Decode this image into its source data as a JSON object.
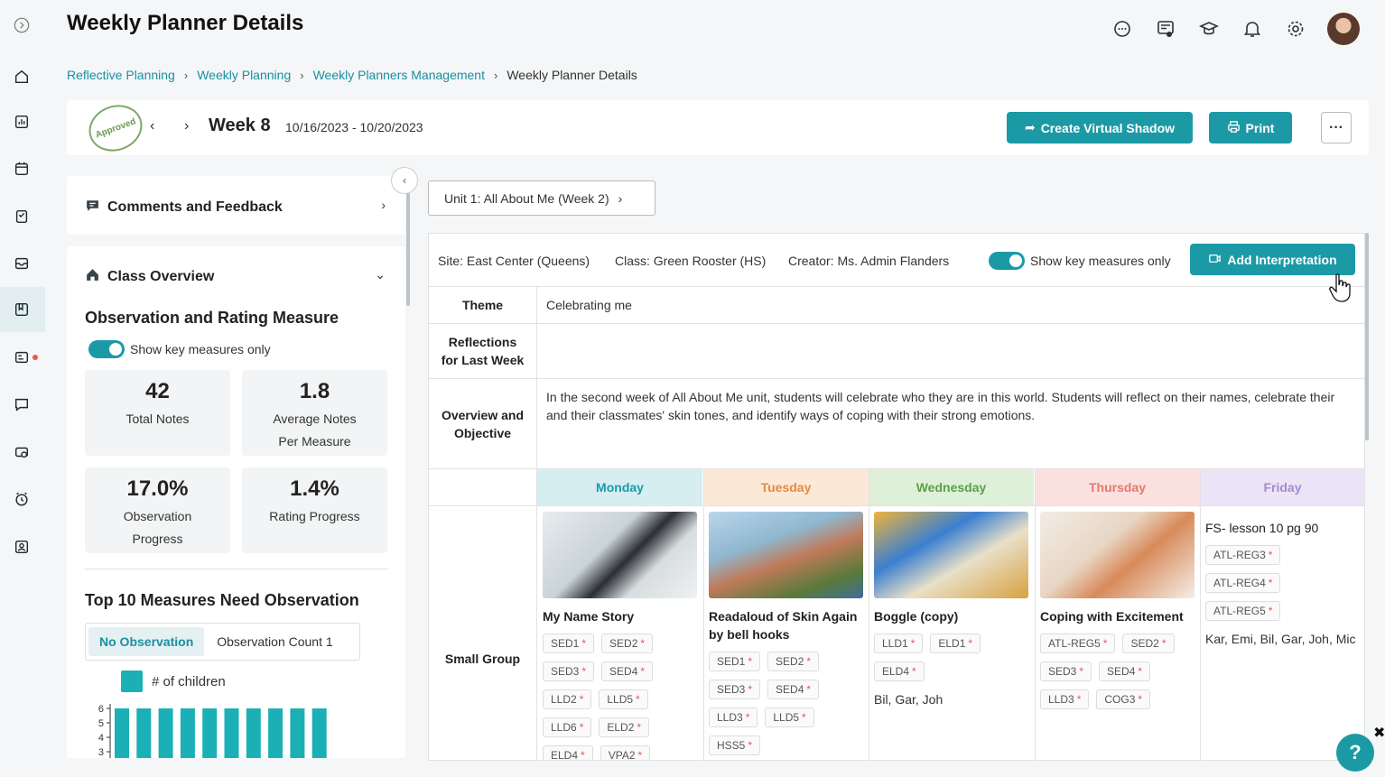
{
  "header": {
    "title": "Weekly Planner Details",
    "icons": [
      "chat-icon",
      "feedback-icon",
      "graduation-cap-icon",
      "bell-icon",
      "gear-icon",
      "avatar"
    ]
  },
  "sidebar": {
    "items": [
      "expand-icon",
      "home-icon",
      "chart-icon",
      "calendar-icon",
      "clipboard-icon",
      "inbox-icon",
      "planner-icon",
      "report-icon",
      "message-icon",
      "media-icon",
      "clock-icon",
      "profile-icon"
    ]
  },
  "breadcrumb": {
    "items": [
      "Reflective Planning",
      "Weekly Planning",
      "Weekly Planners Management"
    ],
    "current": "Weekly Planner Details"
  },
  "week": {
    "stamp": "Approved",
    "label": "Week 8",
    "dates": "10/16/2023 - 10/20/2023",
    "create_label": "Create Virtual Shadow",
    "print_label": "Print",
    "more_label": "···"
  },
  "left_panel": {
    "comments_title": "Comments and Feedback",
    "class_title": "Class Overview",
    "measure_title": "Observation and Rating Measure",
    "toggle_label": "Show key measures only",
    "stats": [
      {
        "value": "42",
        "label1": "Total Notes",
        "label2": ""
      },
      {
        "value": "1.8",
        "label1": "Average Notes",
        "label2": "Per Measure"
      },
      {
        "value": "17.0%",
        "label1": "Observation",
        "label2": "Progress"
      },
      {
        "value": "1.4%",
        "label1": "Rating Progress",
        "label2": ""
      }
    ],
    "top10_title": "Top 10 Measures Need Observation",
    "tab_active": "No Observation",
    "tab_inactive": "Observation Count 1",
    "legend": "# of children",
    "y_ticks": [
      "6",
      "5",
      "4",
      "3"
    ]
  },
  "chart_data": {
    "type": "bar",
    "categories": [
      "",
      "",
      "",
      "",
      "",
      "",
      "",
      "",
      "",
      ""
    ],
    "values": [
      6,
      6,
      6,
      6,
      6,
      6,
      6,
      6,
      6,
      6
    ],
    "ylim": [
      3,
      6
    ],
    "series_name": "# of children",
    "color": "#1bb0b5"
  },
  "unit": {
    "label": "Unit 1: All About Me (Week 2)"
  },
  "details": {
    "site": "Site: East Center (Queens)",
    "class": "Class: Green Rooster (HS)",
    "creator": "Creator: Ms. Admin Flanders",
    "toggle_label": "Show key measures only",
    "add_label": "Add Interpretation",
    "theme_head": "Theme",
    "theme": "Celebrating me",
    "reflections_head1": "Reflections",
    "reflections_head2": "for Last Week",
    "overview_head1": "Overview and",
    "overview_head2": "Objective",
    "overview": "In the second week of All About Me unit, students will celebrate who they are in this world. Students will reflect on their names, celebrate their and their classmates' skin tones, and identify ways of coping with their strong emotions.",
    "small_group_head": "Small Group"
  },
  "days": [
    {
      "name": "Monday",
      "bg": "#d6eef1",
      "color": "#1a9aa8"
    },
    {
      "name": "Tuesday",
      "bg": "#fbe8d7",
      "color": "#e58a45"
    },
    {
      "name": "Wednesday",
      "bg": "#def0d8",
      "color": "#5aa04a"
    },
    {
      "name": "Thursday",
      "bg": "#fbe0e0",
      "color": "#e07a6a"
    },
    {
      "name": "Friday",
      "bg": "#ebe3f6",
      "color": "#a48ad0"
    }
  ],
  "activities": [
    {
      "title": "My Name Story",
      "tags": [
        "SED1",
        "SED2",
        "SED3",
        "SED4",
        "LLD2",
        "LLD5",
        "LLD6",
        "ELD2",
        "ELD4",
        "VPA2"
      ],
      "kids": ""
    },
    {
      "title": "Readaloud of Skin Again by bell hooks",
      "tags": [
        "SED1",
        "SED2",
        "SED3",
        "SED4",
        "LLD3",
        "LLD5",
        "HSS5"
      ],
      "kids": ""
    },
    {
      "title": "Boggle (copy)",
      "tags": [
        "LLD1",
        "ELD1",
        "ELD4"
      ],
      "kids": "Bil, Gar, Joh"
    },
    {
      "title": "Coping with Excitement",
      "tags": [
        "ATL-REG5",
        "SED2",
        "SED3",
        "SED4",
        "LLD3",
        "COG3"
      ],
      "kids": ""
    },
    {
      "title": "FS- lesson 10 pg 90",
      "tags": [
        "ATL-REG3",
        "ATL-REG4",
        "ATL-REG5"
      ],
      "kids": "Kar, Emi, Bil, Gar, Joh, Mic"
    }
  ],
  "help": "?",
  "close": "✖"
}
